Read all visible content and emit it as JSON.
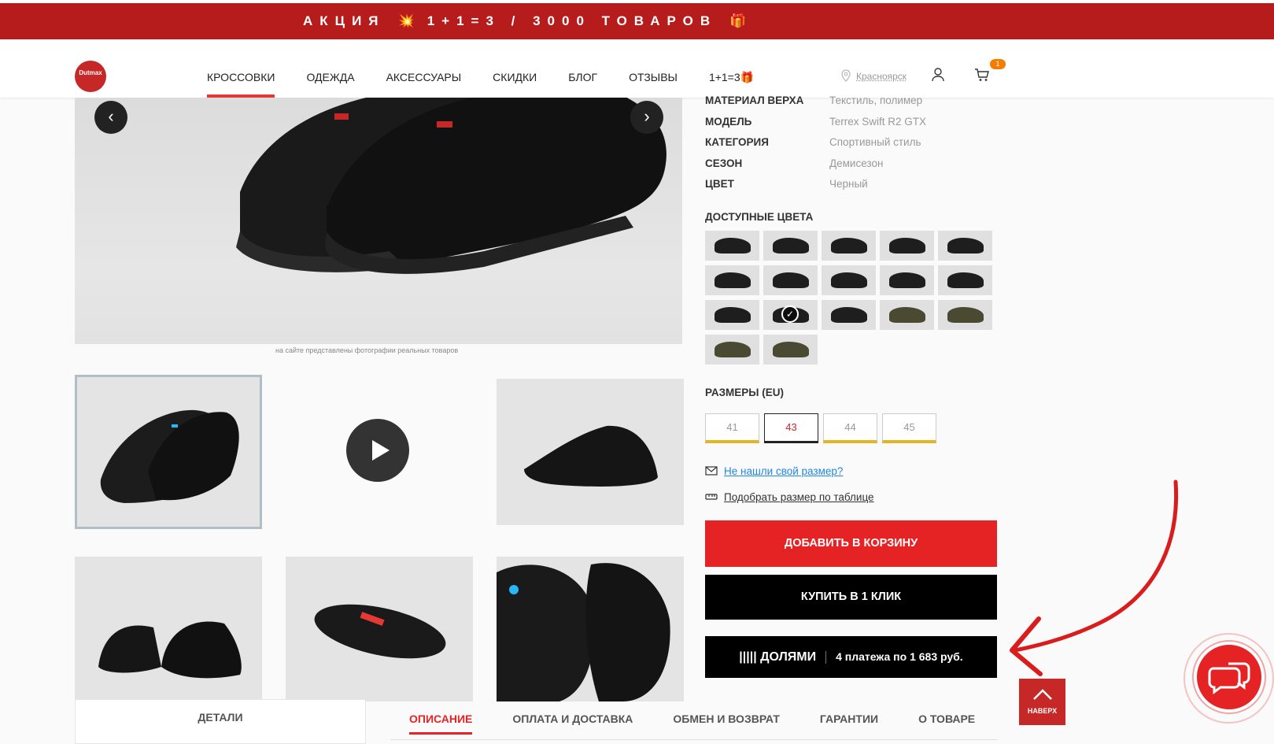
{
  "promo": {
    "part1": "АКЦИЯ",
    "burst": "💥",
    "part2": "1+1=3 / 3000 ТОВАРОВ",
    "gift": "🎁"
  },
  "header": {
    "logo_text": "Dutmax",
    "nav": [
      {
        "label": "КРОССОВКИ",
        "active": true
      },
      {
        "label": "ОДЕЖДА"
      },
      {
        "label": "АКСЕССУАРЫ"
      },
      {
        "label": "СКИДКИ"
      },
      {
        "label": "БЛОГ"
      },
      {
        "label": "ОТЗЫВЫ"
      },
      {
        "label": "1+1=3",
        "icon": "🎁"
      }
    ],
    "city": "Красноярск",
    "cart_count": "1"
  },
  "gallery": {
    "caption": "на сайте представлены фотографии реальных товаров"
  },
  "specs": [
    {
      "key": "МАТЕРИАЛ ВЕРХА",
      "value": "Текстиль, полимер"
    },
    {
      "key": "МОДЕЛЬ",
      "value": "Terrex Swift R2 GTX"
    },
    {
      "key": "КАТЕГОРИЯ",
      "value": "Спортивный стиль"
    },
    {
      "key": "СЕЗОН",
      "value": "Демисезон"
    },
    {
      "key": "ЦВЕТ",
      "value": "Черный"
    }
  ],
  "colors_title": "ДОСТУПНЫЕ ЦВЕТА",
  "sizes_title": "РАЗМЕРЫ (EU)",
  "sizes": [
    "41",
    "43",
    "44",
    "45"
  ],
  "selected_size": "43",
  "links": {
    "no_size": "Не нашли свой размер?",
    "size_table": "Подобрать размер по таблице"
  },
  "buttons": {
    "add_to_cart": "ДОБАВИТЬ В КОРЗИНУ",
    "buy_one_click": "КУПИТЬ В 1 КЛИК",
    "dolyami_brand": "||||| ДОЛЯМИ",
    "dolyami_text": "4 платежа по 1 683 руб."
  },
  "tabs": {
    "details": "ДЕТАЛИ",
    "items": [
      "ОПИСАНИЕ",
      "ОПЛАТА И ДОСТАВКА",
      "ОБМЕН И ВОЗВРАТ",
      "ГАРАНТИИ",
      "О ТОВАРЕ"
    ],
    "active": "ОПИСАНИЕ"
  },
  "scroll_up": "НАВЕРХ",
  "colors": {
    "accent": "#e52325",
    "promo_bg": "#b71c1c",
    "size_bar": "#e6b422"
  }
}
